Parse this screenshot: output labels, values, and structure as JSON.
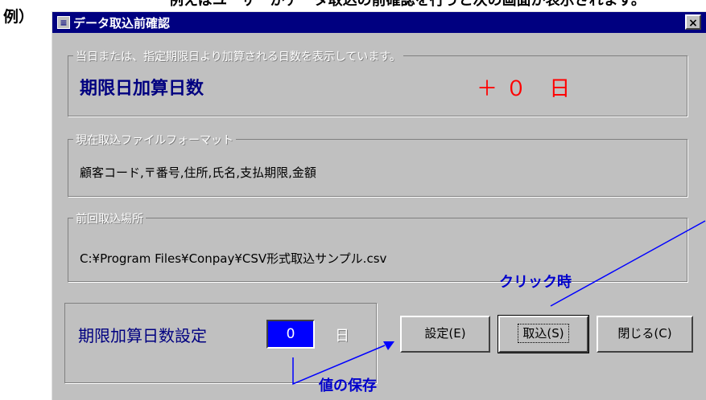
{
  "prefix_label": "例）",
  "window": {
    "title": "データ取込前確認",
    "title_icon": "form-icon",
    "close_glyph": "×"
  },
  "group_add_days": {
    "caption": "当日または、指定期限日より加算される日数を表示しています。",
    "label": "期限日加算日数",
    "value_text": "＋０ 日"
  },
  "group_format": {
    "caption": "現在取込ファイルフォーマット",
    "value": "顧客コード,〒番号,住所,氏名,支払期限,金額"
  },
  "group_last_location": {
    "caption": "前回取込場所",
    "value": "C:¥Program Files¥Conpay¥CSV形式取込サンプル.csv"
  },
  "group_setting": {
    "label": "期限加算日数設定",
    "input_value": "0",
    "unit": "日"
  },
  "buttons": {
    "set": "設定(E)",
    "import": "取込(S)",
    "close": "閉じる(C)"
  },
  "annotations": {
    "click": "クリック時",
    "save": "値の保存"
  },
  "colors": {
    "titlebar": "#000080",
    "window_face": "#c0c0c0",
    "emphasis_text": "#000080",
    "add_days_value": "#ff0000",
    "input_bg": "#0000ff",
    "annotation": "#0000cc"
  }
}
